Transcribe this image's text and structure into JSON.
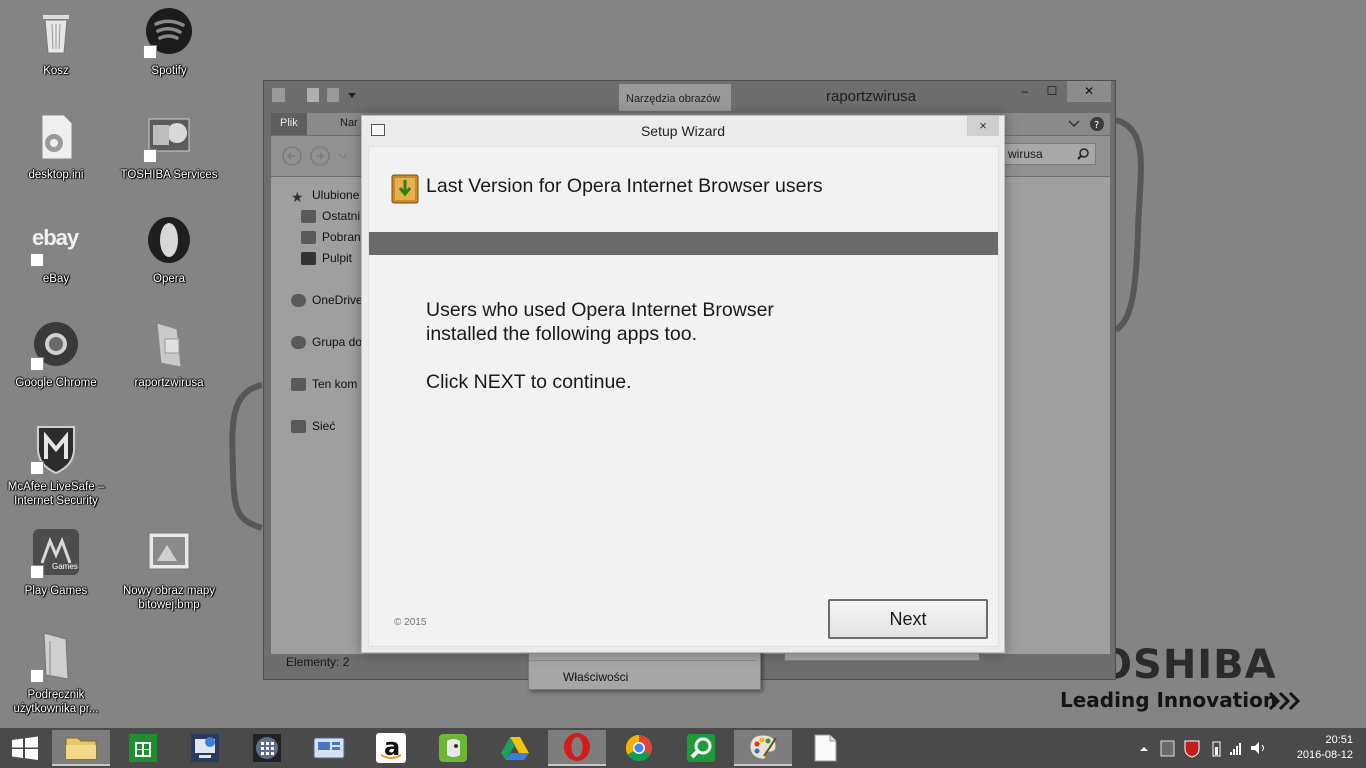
{
  "desktop": {
    "icons": [
      {
        "label": "Kosz",
        "icon": "recycle-bin-icon"
      },
      {
        "label": "Spotify",
        "icon": "spotify-icon"
      },
      {
        "label": "desktop.ini",
        "icon": "settings-file-icon"
      },
      {
        "label": "TOSHIBA Services",
        "icon": "toshiba-services-icon"
      },
      {
        "label": "eBay",
        "icon": "ebay-icon"
      },
      {
        "label": "Opera",
        "icon": "opera-icon"
      },
      {
        "label": "Google Chrome",
        "icon": "chrome-icon"
      },
      {
        "label": "raportzwirusa",
        "icon": "folder-icon"
      },
      {
        "label": "McAfee LiveSafe – Internet Security",
        "icon": "mcafee-icon"
      },
      {
        "label": "Play Games",
        "icon": "play-games-icon"
      },
      {
        "label": "Nowy obraz mapy bitowej.bmp",
        "icon": "bitmap-icon"
      },
      {
        "label": "Podręcznik użytkownika pr...",
        "icon": "manual-icon"
      }
    ],
    "ebay_logo_text": "ebay",
    "games_badge": "Games",
    "brand": "TOSHIBA",
    "brand_visible": "OSHIBA",
    "tagline": "Leading Innovation"
  },
  "explorer": {
    "title": "raportzwirusa",
    "context_tab": "Narzędzia obrazów",
    "ribbon_tabs": [
      "Plik",
      "Nar"
    ],
    "search_text": "wirusa",
    "nav": [
      {
        "label": "Ulubione"
      },
      {
        "label": "Ostatni"
      },
      {
        "label": "Pobran"
      },
      {
        "label": "Pulpit"
      },
      {
        "label": "OneDrive"
      },
      {
        "label": "Grupa do"
      },
      {
        "label": "Ten kom"
      },
      {
        "label": "Sieć"
      }
    ],
    "status": "Elementy: 2",
    "minimize": "–",
    "maximize": "☐",
    "close": "✕"
  },
  "context_menu": {
    "item": "Właściwości"
  },
  "wizard": {
    "title": "Setup Wizard",
    "close": "×",
    "heading": "Last Version for Opera Internet Browser users",
    "message_line1": "Users who used Opera Internet Browser",
    "message_line2": "installed the following apps too.",
    "message_line3": "Click NEXT to continue.",
    "copyright": "© 2015",
    "next_label": "Next"
  },
  "taskbar": {
    "apps": [
      {
        "name": "file-explorer",
        "icon": "folder-icon",
        "active": true
      },
      {
        "name": "store",
        "icon": "store-icon",
        "active": false
      },
      {
        "name": "remote-desktop",
        "icon": "monitor-icon",
        "active": false
      },
      {
        "name": "calculator",
        "icon": "grid-icon",
        "active": false
      },
      {
        "name": "display-settings",
        "icon": "display-icon",
        "active": false
      },
      {
        "name": "amazon",
        "icon": "amazon-icon",
        "active": false
      },
      {
        "name": "evernote",
        "icon": "evernote-icon",
        "active": false
      },
      {
        "name": "google-drive",
        "icon": "drive-icon",
        "active": false
      },
      {
        "name": "opera",
        "icon": "opera-icon",
        "active": true
      },
      {
        "name": "chrome",
        "icon": "chrome-icon",
        "active": false
      },
      {
        "name": "search-tool",
        "icon": "magnifier-icon",
        "active": false
      },
      {
        "name": "paint",
        "icon": "palette-icon",
        "active": true
      },
      {
        "name": "notepad",
        "icon": "document-icon",
        "active": false
      }
    ],
    "amazon_letter": "a",
    "clock_time": "20:51",
    "clock_date": "2016-08-12"
  }
}
